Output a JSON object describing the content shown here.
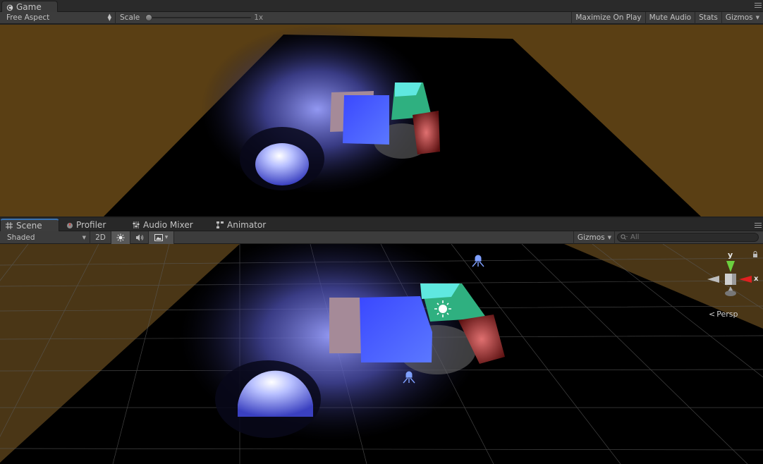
{
  "game": {
    "tab_label": "Game",
    "aspect": "Free Aspect",
    "scale_label": "Scale",
    "scale_value": "1x",
    "buttons": [
      "Maximize On Play",
      "Mute Audio",
      "Stats",
      "Gizmos"
    ]
  },
  "scene": {
    "tabs": [
      "Scene",
      "Profiler",
      "Audio Mixer",
      "Animator"
    ],
    "shading": "Shaded",
    "mode_2d": "2D",
    "gizmos": "Gizmos",
    "search_placeholder": "All",
    "gizmo_axes": {
      "y": "y",
      "x": "x"
    },
    "projection": "Persp"
  },
  "colors": {
    "ground": "#5a3f14",
    "scene_bg": "#4a3616",
    "accent_tab": "#3a72b0",
    "cube_blue": "#3a5af5",
    "cube_red": "#c8504f",
    "cube_green": "#36b07a"
  }
}
